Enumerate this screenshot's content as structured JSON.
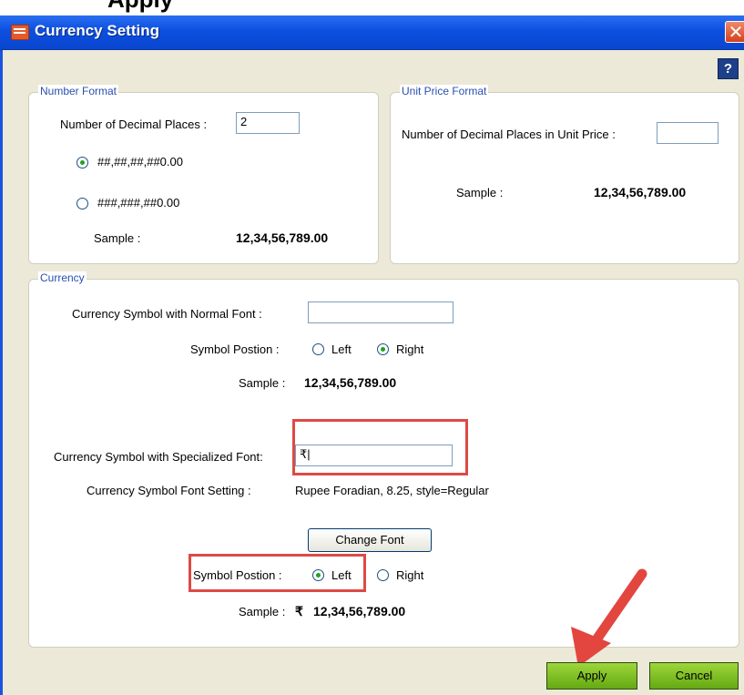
{
  "window": {
    "title": "Currency Setting",
    "close_glyph": "✕",
    "help_glyph": "?"
  },
  "number_format": {
    "legend": "Number Format",
    "decimal_places_label": "Number of Decimal Places :",
    "decimal_places_value": "2",
    "option_indian": "##,##,##,##0.00",
    "option_international": "###,###,##0.00",
    "selected_option": "indian",
    "sample_label": "Sample :",
    "sample_value": "12,34,56,789.00"
  },
  "unit_price_format": {
    "legend": "Unit Price Format",
    "decimal_places_label": "Number of Decimal Places in Unit Price :",
    "decimal_places_value": "",
    "sample_label": "Sample :",
    "sample_value": "12,34,56,789.00"
  },
  "currency": {
    "legend": "Currency",
    "normal_font_label": "Currency Symbol  with Normal Font :",
    "normal_font_value": "",
    "normal_position_label": "Symbol Postion :",
    "left_label": "Left",
    "right_label": "Right",
    "normal_position_selected": "right",
    "normal_sample_label": "Sample :",
    "normal_sample_value": "12,34,56,789.00",
    "special_font_label": "Currency Symbol with Specialized Font:",
    "special_font_value": "₹|",
    "font_setting_label": "Currency Symbol Font Setting :",
    "font_setting_value": "Rupee Foradian, 8.25, style=Regular",
    "change_font_label": "Change Font",
    "special_position_label": "Symbol Postion :",
    "special_position_selected": "left",
    "special_sample_label": "Sample :",
    "special_sample_symbol": "₹",
    "special_sample_value": "12,34,56,789.00"
  },
  "footer": {
    "apply_label": "Apply",
    "cancel_label": "Cancel"
  },
  "colors": {
    "titlebar": "#0c4fe0",
    "highlight": "#dd4a45",
    "button_green": "#65a913"
  }
}
